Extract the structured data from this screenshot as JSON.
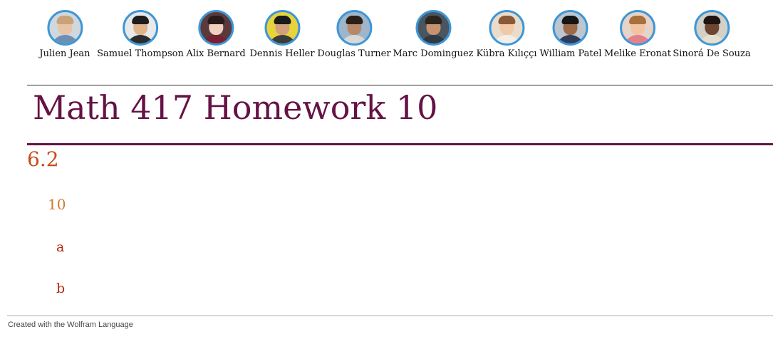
{
  "collaborators": [
    {
      "name": "Julien Jean",
      "icon": "avatar-julien-jean",
      "colors": {
        "bg": "#cfd8dc",
        "skin": "#e8c3a5",
        "hair": "#c9a27a",
        "shirt": "#6c8fb3"
      }
    },
    {
      "name": "Samuel Thompson",
      "icon": "avatar-samuel-thompson",
      "colors": {
        "bg": "#e9e9e9",
        "skin": "#e0b48a",
        "hair": "#1d1d1d",
        "shirt": "#2c2c2c"
      }
    },
    {
      "name": "Alix Bernard",
      "icon": "avatar-alix-bernard",
      "colors": {
        "bg": "#5a3a3a",
        "skin": "#f0d0c0",
        "hair": "#2a1b1b",
        "shirt": "#7a2030"
      }
    },
    {
      "name": "Dennis Heller",
      "icon": "avatar-dennis-heller",
      "colors": {
        "bg": "#e7d43c",
        "skin": "#d2a07a",
        "hair": "#1a1a1a",
        "shirt": "#3c3c3c"
      }
    },
    {
      "name": "Douglas Turner",
      "icon": "avatar-douglas-turner",
      "colors": {
        "bg": "#9fb5c9",
        "skin": "#b7876a",
        "hair": "#2a2018",
        "shirt": "#d8d8d8"
      }
    },
    {
      "name": "Marc Dominguez",
      "icon": "avatar-marc-dominguez",
      "colors": {
        "bg": "#4a5560",
        "skin": "#c89270",
        "hair": "#2c241e",
        "shirt": "#2f3a45"
      }
    },
    {
      "name": "Kübra Kılıççı",
      "icon": "avatar-kubra-kilicci",
      "colors": {
        "bg": "#eadccc",
        "skin": "#f1c8a8",
        "hair": "#8a5a36",
        "shirt": "#f3eee8"
      }
    },
    {
      "name": "William Patel",
      "icon": "avatar-william-patel",
      "colors": {
        "bg": "#bcc6cf",
        "skin": "#9c6a48",
        "hair": "#151515",
        "shirt": "#2e3c5a"
      }
    },
    {
      "name": "Melike Eronat",
      "icon": "avatar-melike-eronat",
      "colors": {
        "bg": "#e6d3c9",
        "skin": "#f2c4a3",
        "hair": "#a8703c",
        "shirt": "#e57f8a"
      }
    },
    {
      "name": "Sinorá De Souza",
      "icon": "avatar-sinora-de-souza",
      "colors": {
        "bg": "#d2d0c8",
        "skin": "#6e4530",
        "hair": "#1e1410",
        "shirt": "#e6e0cf"
      }
    }
  ],
  "document": {
    "title": "Math 417 Homework 10",
    "section": "6.2",
    "subsection": "10",
    "items": [
      "a",
      "b"
    ]
  },
  "footer": {
    "text": "Created with the Wolfram Language"
  },
  "colors": {
    "title": "#651245",
    "section": "#c74b1a",
    "subsection": "#d07a2d",
    "subsubsection": "#b8260d",
    "avatar_ring": "#3e97d6"
  }
}
